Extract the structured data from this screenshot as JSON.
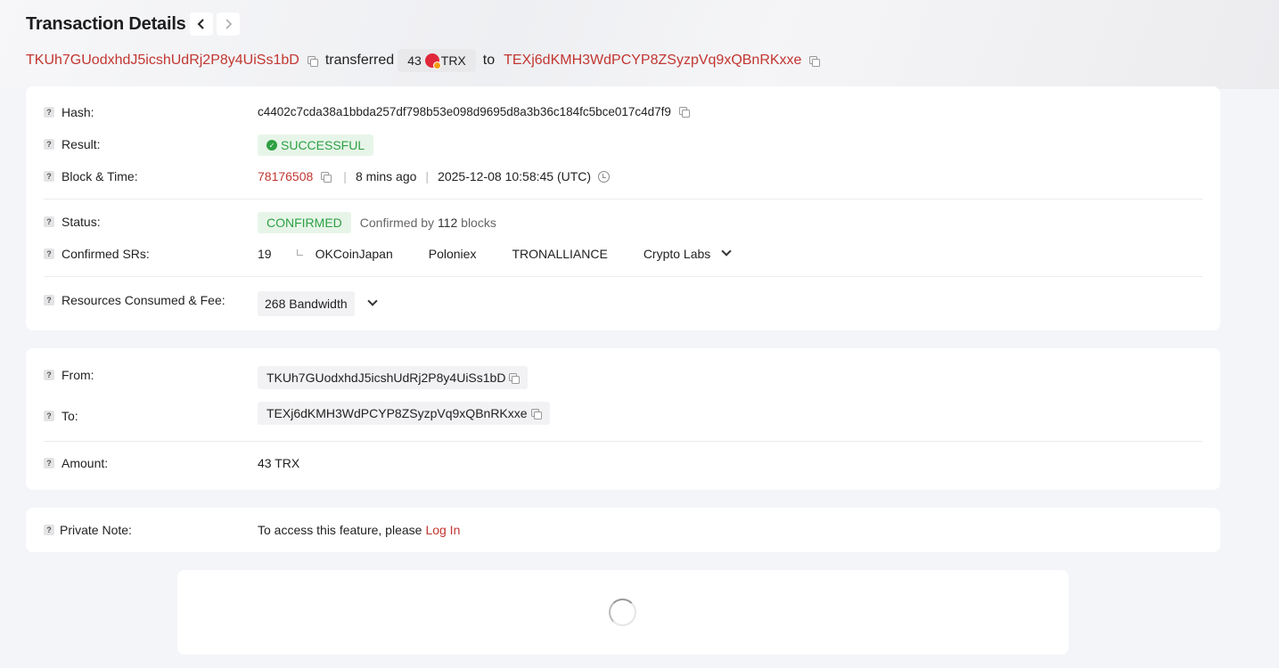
{
  "header": {
    "title": "Transaction Details",
    "prev_icon": "chevron-left-icon",
    "next_icon": "chevron-right-icon"
  },
  "summary": {
    "from_address": "TKUh7GUodxhdJ5icshUdRj2P8y4UiSs1bD",
    "verb": "transferred",
    "amount": "43",
    "token": "TRX",
    "to_word": "to",
    "to_address": "TEXj6dKMH3WdPCYP8ZSyzpVq9xQBnRKxxe"
  },
  "overview": {
    "hash_label": "Hash:",
    "hash_value": "c4402c7cda38a1bbda257df798b53e098d9695d8a3b36c184fc5bce017c4d7f9",
    "result_label": "Result:",
    "result_value": "SUCCESSFUL",
    "block_label": "Block & Time:",
    "block_number": "78176508",
    "age": "8 mins ago",
    "timestamp": "2025-12-08 10:58:45 (UTC)",
    "status_label": "Status:",
    "status_value": "CONFIRMED",
    "confirmed_by_prefix": "Confirmed by",
    "confirmed_blocks": "112",
    "confirmed_by_suffix": "blocks",
    "srs_label": "Confirmed SRs:",
    "srs_count": "19",
    "srs": [
      "OKCoinJapan",
      "Poloniex",
      "TRONALLIANCE",
      "Crypto Labs"
    ],
    "resources_label": "Resources Consumed & Fee:",
    "resources_value": "268 Bandwidth"
  },
  "transfer": {
    "from_label": "From:",
    "from_value": "TKUh7GUodxhdJ5icshUdRj2P8y4UiSs1bD",
    "to_label": "To:",
    "to_value": "TEXj6dKMH3WdPCYP8ZSyzpVq9xQBnRKxxe",
    "amount_label": "Amount:",
    "amount_value": "43 TRX"
  },
  "note": {
    "label": "Private Note:",
    "text": "To access this feature, please",
    "login": "Log In"
  },
  "colors": {
    "accent": "#c23631",
    "success": "#2ea043",
    "background": "#f4f5f8"
  }
}
